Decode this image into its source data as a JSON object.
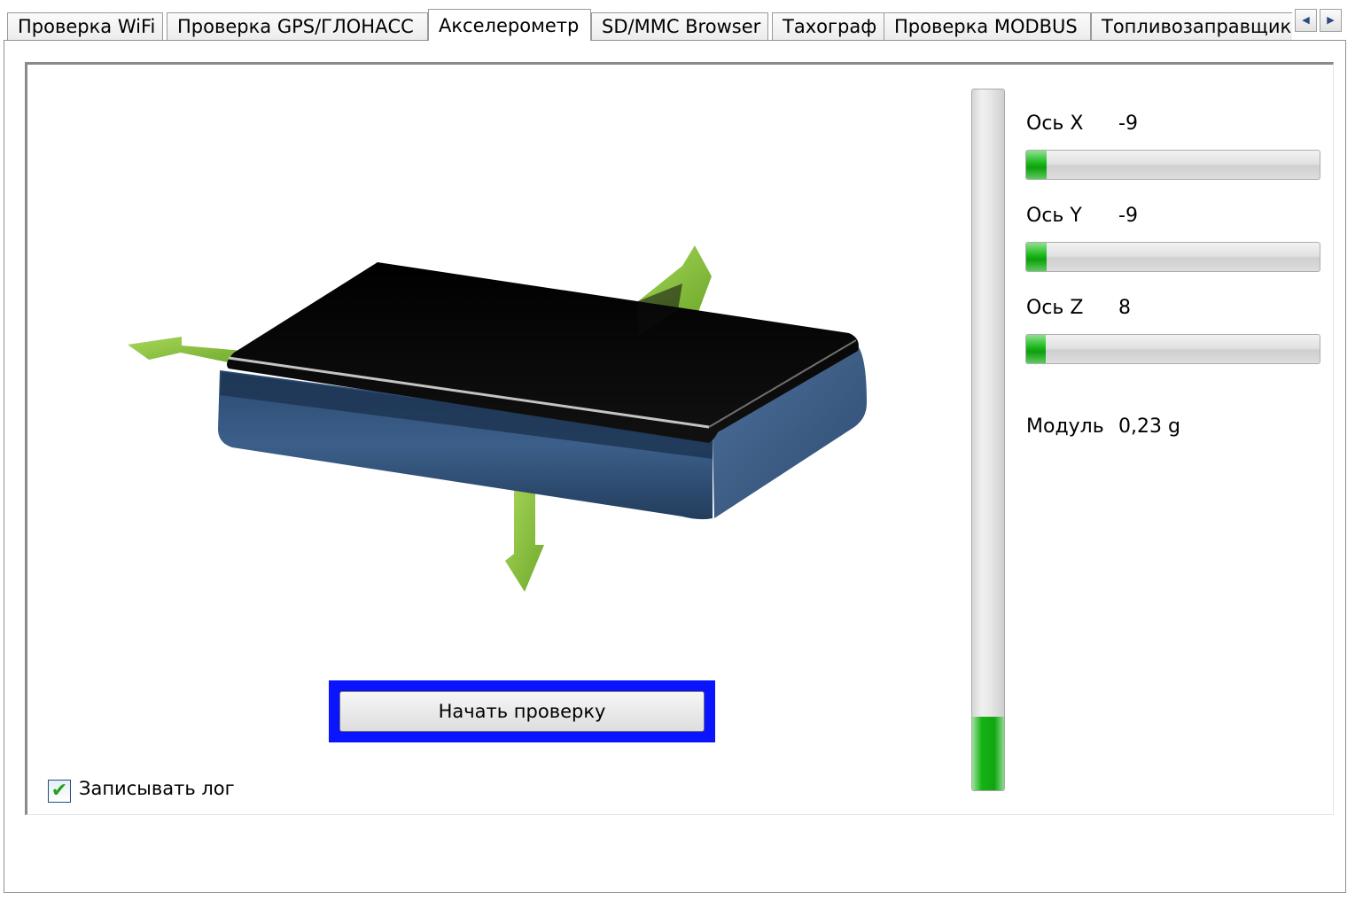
{
  "tabs": [
    {
      "label": "Проверка WiFi",
      "active": false
    },
    {
      "label": "Проверка GPS/ГЛОНАСС",
      "active": false
    },
    {
      "label": "Акселерометр",
      "active": true
    },
    {
      "label": "SD/MMC Browser",
      "active": false
    },
    {
      "label": "Тахограф",
      "active": false
    },
    {
      "label": "Проверка MODBUS",
      "active": false
    },
    {
      "label": "Топливозаправщик",
      "active": false
    }
  ],
  "tab_scroll": {
    "left": "◀",
    "right": "▶"
  },
  "axes": [
    {
      "label": "Ось X",
      "value": "-9",
      "fill_fraction": 0.07
    },
    {
      "label": "Ось Y",
      "value": "-9",
      "fill_fraction": 0.07
    },
    {
      "label": "Ось Z",
      "value": "8",
      "fill_fraction": 0.065
    }
  ],
  "module": {
    "label": "Модуль",
    "value": "0,23 g"
  },
  "vertical_meter": {
    "fill_fraction": 0.105
  },
  "start_button": {
    "label": "Начать проверку"
  },
  "log_checkbox": {
    "label": "Записывать лог",
    "checked": true,
    "mark": "✔"
  },
  "colors": {
    "focus_frame": "#0a14ff",
    "meter_green": "#15b215",
    "arrow_green": "#8cc640",
    "device_top": "#050505",
    "device_side": "#3a5a80"
  },
  "icons": {
    "device": "device-3d-illustration",
    "arrows": [
      "arrow-x-icon",
      "arrow-y-icon",
      "arrow-z-icon"
    ]
  }
}
